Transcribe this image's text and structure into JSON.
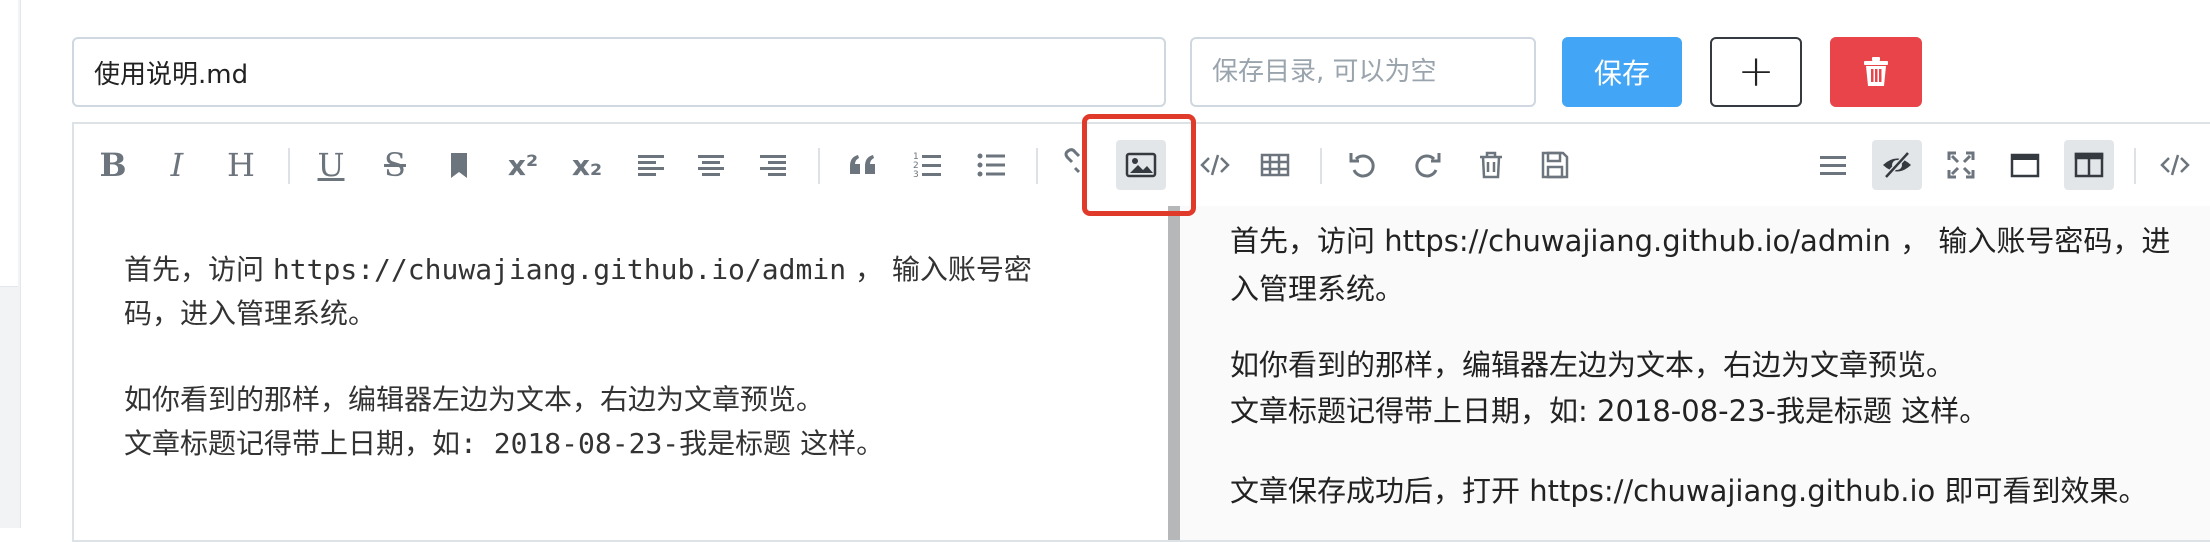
{
  "form": {
    "title_value": "使用说明.md",
    "dir_placeholder": "保存目录, 可以为空",
    "save_label": "保存",
    "add_label": "+"
  },
  "toolbar": {
    "bold": "B",
    "italic": "I",
    "heading": "H",
    "underline": "U",
    "strikethrough": "S",
    "superscript": "x²",
    "subscript": "x₂"
  },
  "source": {
    "line1_a": "首先，访问 ",
    "line1_url": "https://chuwajiang.github.io/admin",
    "line1_b": " ， 输入账号密",
    "line2": "码，进入管理系统。",
    "line3": "如你看到的那样，编辑器左边为文本，右边为文章预览。",
    "line4_a": "文章标题记得带上日期，如",
    "line4_b": ": 2018-08-23-",
    "line4_c": "我是标题  这样。"
  },
  "preview": {
    "p1_line1": "首先，访问 https://chuwajiang.github.io/admin ， 输入账号密码，进",
    "p1_line2": "入管理系统。",
    "p2_line1": "如你看到的那样，编辑器左边为文本，右边为文章预览。",
    "p2_line2": "文章标题记得带上日期，如: 2018-08-23-我是标题 这样。",
    "p3_line1": "文章保存成功后，打开 https://chuwajiang.github.io 即可看到效果。"
  },
  "icons": {
    "toolbar": [
      "bold-icon",
      "italic-icon",
      "heading-icon",
      "underline-icon",
      "strikethrough-icon",
      "bookmark-icon",
      "superscript-icon",
      "subscript-icon",
      "align-left-icon",
      "align-center-icon",
      "align-right-icon",
      "quote-icon",
      "ordered-list-icon",
      "unordered-list-icon",
      "link-icon",
      "image-icon",
      "code-icon",
      "table-icon",
      "undo-icon",
      "redo-icon",
      "trash-icon",
      "save-icon",
      "menu-icon",
      "preview-toggle-icon",
      "fullscreen-icon",
      "window-icon",
      "split-view-icon",
      "html-code-icon"
    ]
  },
  "colors": {
    "primary": "#42a5f5",
    "danger": "#e8444a",
    "highlight": "#e03a2a"
  }
}
